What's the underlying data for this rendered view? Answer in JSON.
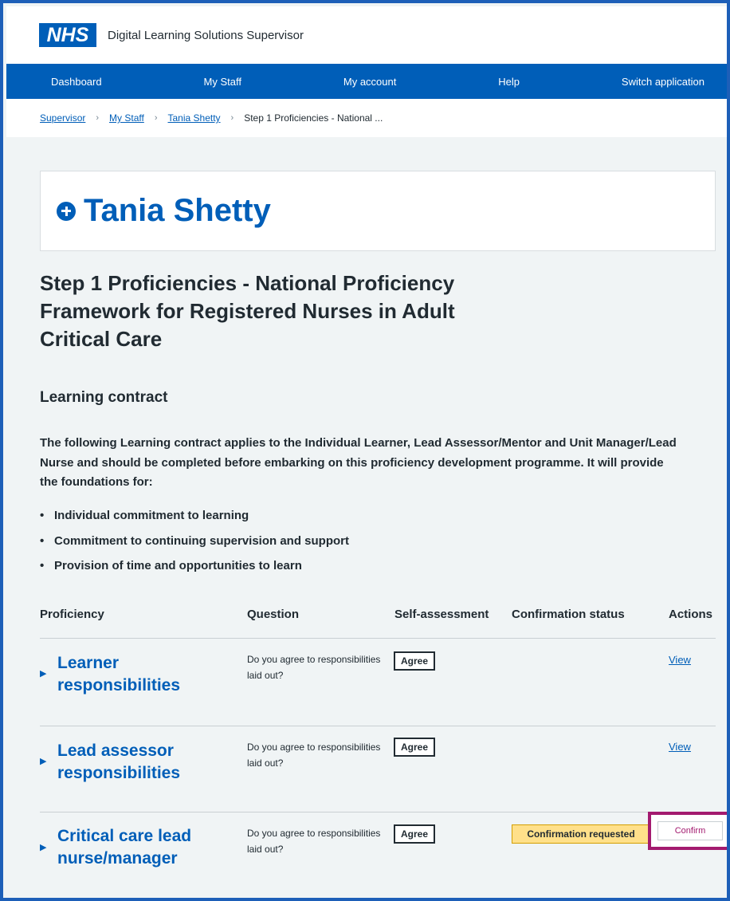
{
  "header": {
    "logo": "NHS",
    "service_name": "Digital Learning Solutions Supervisor"
  },
  "nav": [
    "Dashboard",
    "My Staff",
    "My account",
    "Help",
    "Switch application"
  ],
  "breadcrumb": {
    "links": [
      "Supervisor",
      "My Staff",
      "Tania Shetty"
    ],
    "current": "Step 1 Proficiencies - National ..."
  },
  "learner": {
    "name": "Tania Shetty",
    "icon": "plus-circle-icon"
  },
  "page_title": "Step 1 Proficiencies - National Proficiency Framework for Registered Nurses in Adult Critical Care",
  "section_title": "Learning contract",
  "intro": "The following Learning contract applies to the Individual Learner, Lead Assessor/Mentor and Unit Manager/Lead Nurse and should be completed before embarking on this proficiency development programme. It will provide the foundations for:",
  "bullets": [
    "Individual commitment to learning",
    "Commitment to continuing supervision and support",
    "Provision of time and opportunities to learn"
  ],
  "table": {
    "headers": [
      "Proficiency",
      "Question",
      "Self-assessment",
      "Confirmation status",
      "Actions"
    ],
    "rows": [
      {
        "proficiency": "Learner responsibilities",
        "question": "Do you agree to responsibilities laid out?",
        "self_assessment": "Agree",
        "status": "",
        "action": "View"
      },
      {
        "proficiency": "Lead assessor responsibilities",
        "question": "Do you agree to responsibilities laid out?",
        "self_assessment": "Agree",
        "status": "",
        "action": "View"
      },
      {
        "proficiency": "Critical care lead nurse/manager",
        "question": "Do you agree to responsibilities laid out?",
        "self_assessment": "Agree",
        "status": "Confirmation requested",
        "action": "Confirm"
      }
    ]
  },
  "colors": {
    "nhs_blue": "#005eb8",
    "highlight": "#a31a6f",
    "status_yellow": "#ffe08a"
  }
}
